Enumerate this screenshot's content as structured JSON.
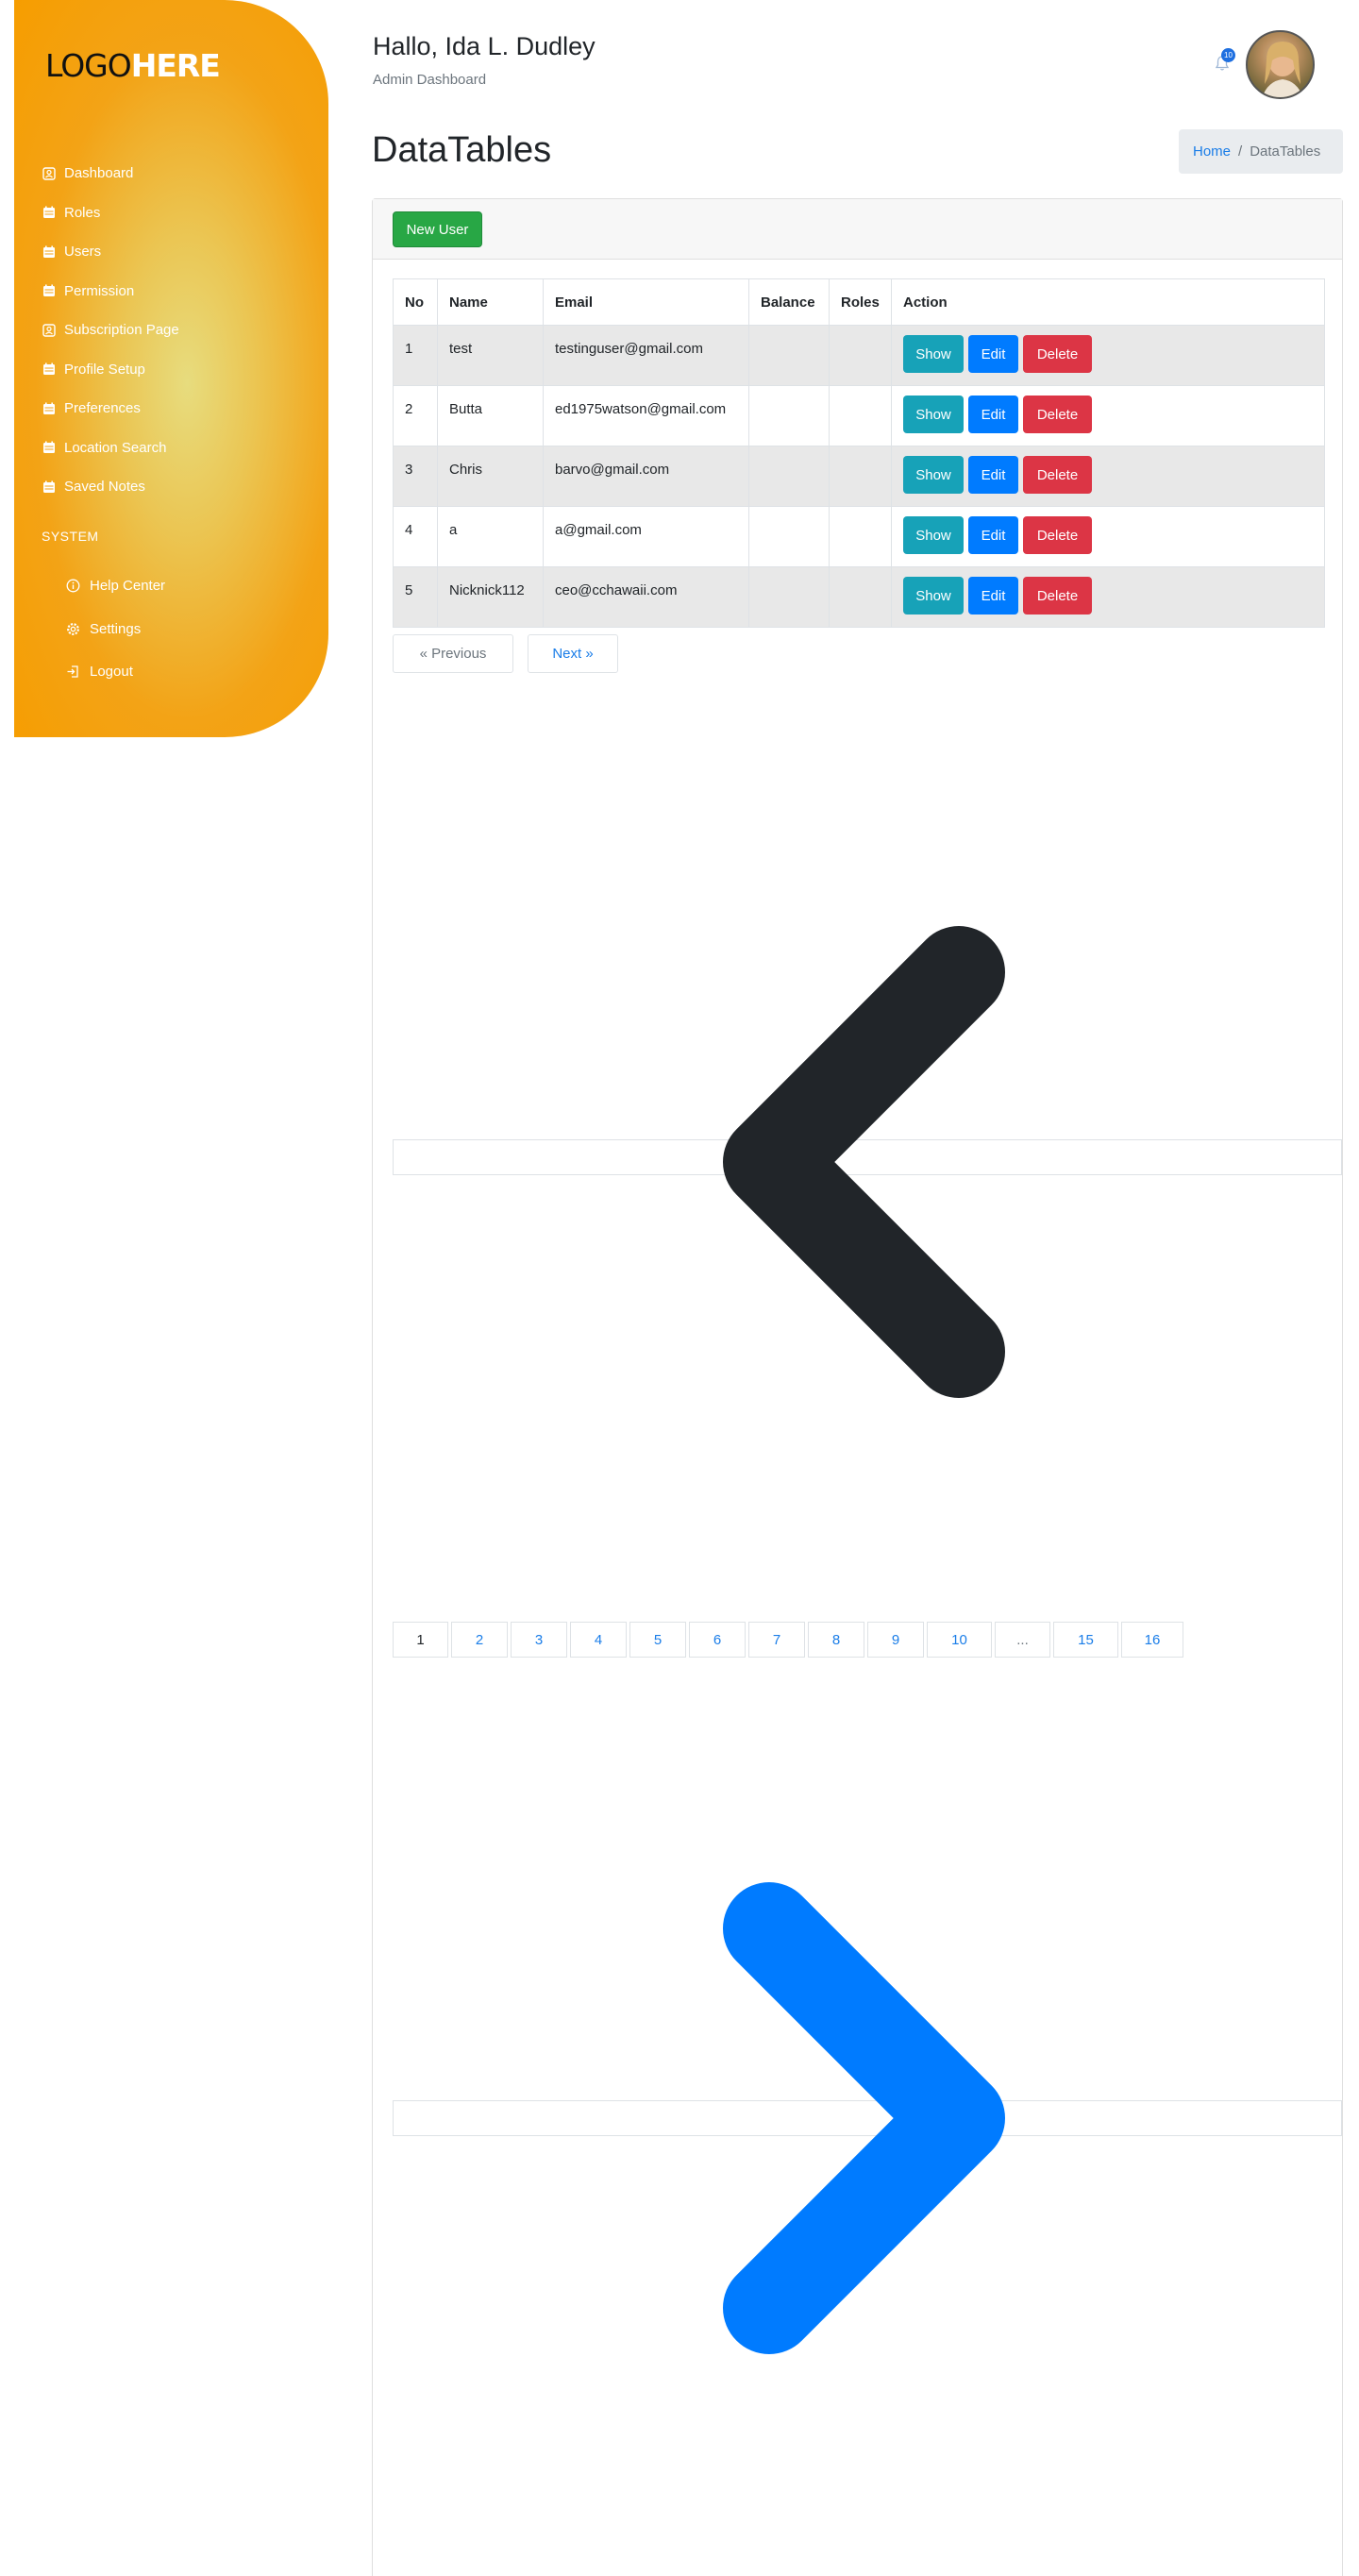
{
  "sidebar": {
    "logo": {
      "part1": "LOGO",
      "part2": "HERE"
    },
    "items": [
      {
        "label": "Dashboard",
        "icon": "dashboard-icon"
      },
      {
        "label": "Roles",
        "icon": "calendar-icon"
      },
      {
        "label": "Users",
        "icon": "calendar-icon"
      },
      {
        "label": "Permission",
        "icon": "calendar-icon"
      },
      {
        "label": "Subscription Page",
        "icon": "dashboard-icon"
      },
      {
        "label": "Profile Setup",
        "icon": "calendar-icon"
      },
      {
        "label": "Preferences",
        "icon": "calendar-icon"
      },
      {
        "label": "Location Search",
        "icon": "calendar-icon"
      },
      {
        "label": "Saved Notes",
        "icon": "calendar-icon"
      }
    ],
    "system_title": "SYSTEM",
    "system_items": [
      {
        "label": "Help Center",
        "icon": "info-icon"
      },
      {
        "label": "Settings",
        "icon": "gear-icon"
      },
      {
        "label": "Logout",
        "icon": "logout-icon"
      }
    ]
  },
  "header": {
    "greeting": "Hallo, Ida L. Dudley",
    "subtitle": "Admin Dashboard",
    "notification_count": "10"
  },
  "page": {
    "title": "DataTables",
    "breadcrumb": {
      "home": "Home",
      "separator": "/",
      "current": "DataTables"
    }
  },
  "card": {
    "new_user_label": "New User",
    "table": {
      "headers": [
        "No",
        "Name",
        "Email",
        "Balance",
        "Roles",
        "Action"
      ],
      "rows": [
        {
          "no": "1",
          "name": "test",
          "email": "testinguser@gmail.com",
          "balance": "",
          "roles": ""
        },
        {
          "no": "2",
          "name": "Butta",
          "email": "ed1975watson@gmail.com",
          "balance": "",
          "roles": ""
        },
        {
          "no": "3",
          "name": "Chris",
          "email": "barvo@gmail.com",
          "balance": "",
          "roles": ""
        },
        {
          "no": "4",
          "name": "a",
          "email": "a@gmail.com",
          "balance": "",
          "roles": ""
        },
        {
          "no": "5",
          "name": "Nicknick112",
          "email": "ceo@cchawaii.com",
          "balance": "",
          "roles": ""
        }
      ],
      "action_labels": {
        "show": "Show",
        "edit": "Edit",
        "delete": "Delete"
      }
    },
    "pager": {
      "previous": "« Previous",
      "next": "Next »"
    },
    "pages": [
      "1",
      "2",
      "3",
      "4",
      "5",
      "6",
      "7",
      "8",
      "9",
      "10",
      "...",
      "15",
      "16"
    ],
    "active_page": "1"
  },
  "colors": {
    "sidebar_orange": "#f69d00",
    "success": "#28a745",
    "info": "#17a2b8",
    "primary": "#007bff",
    "danger": "#dc3545",
    "chevron_prev": "#212529",
    "chevron_next": "#007bff"
  }
}
